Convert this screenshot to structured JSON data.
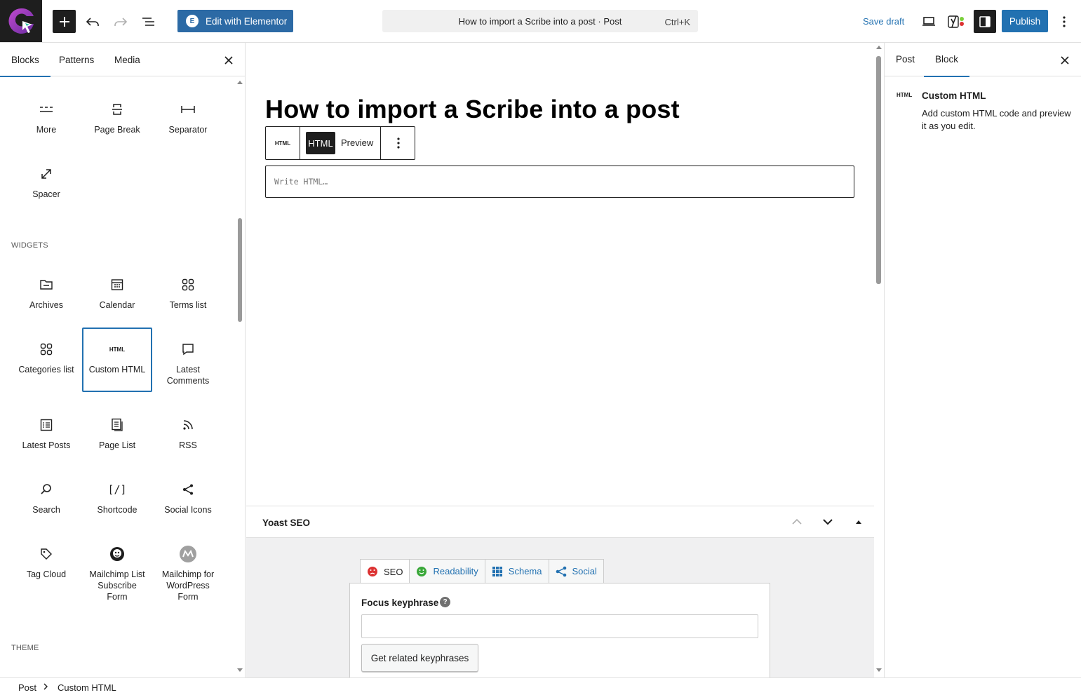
{
  "topbar": {
    "elementor_label": "Edit with Elementor",
    "document_title": "How to import a Scribe into a post · Post",
    "command_shortcut": "Ctrl+K",
    "save_draft": "Save draft",
    "publish": "Publish"
  },
  "inserter": {
    "tabs": [
      "Blocks",
      "Patterns",
      "Media"
    ],
    "active_tab": "Blocks",
    "design_blocks": [
      {
        "label": "More",
        "icon": "more-icon"
      },
      {
        "label": "Page Break",
        "icon": "page-break-icon"
      },
      {
        "label": "Separator",
        "icon": "separator-icon"
      },
      {
        "label": "Spacer",
        "icon": "spacer-icon"
      }
    ],
    "widgets_heading": "WIDGETS",
    "widget_blocks": [
      {
        "label": "Archives",
        "icon": "archives-icon"
      },
      {
        "label": "Calendar",
        "icon": "calendar-icon"
      },
      {
        "label": "Terms list",
        "icon": "terms-list-icon"
      },
      {
        "label": "Categories list",
        "icon": "categories-list-icon"
      },
      {
        "label": "Custom HTML",
        "icon": "custom-html-icon",
        "icon_text": "HTML"
      },
      {
        "label": "Latest Comments",
        "icon": "latest-comments-icon"
      },
      {
        "label": "Latest Posts",
        "icon": "latest-posts-icon"
      },
      {
        "label": "Page List",
        "icon": "page-list-icon"
      },
      {
        "label": "RSS",
        "icon": "rss-icon"
      },
      {
        "label": "Search",
        "icon": "search-icon"
      },
      {
        "label": "Shortcode",
        "icon": "shortcode-icon",
        "icon_text": "[/]"
      },
      {
        "label": "Social Icons",
        "icon": "share-icon"
      },
      {
        "label": "Tag Cloud",
        "icon": "tag-icon"
      },
      {
        "label": "Mailchimp List Subscribe Form",
        "icon": "mailchimp-icon"
      },
      {
        "label": "Mailchimp for WordPress Form",
        "icon": "mc4wp-icon"
      }
    ],
    "theme_heading": "THEME"
  },
  "editor": {
    "post_title": "How to import a Scribe into a post",
    "toolbar": {
      "block_icon_text": "HTML",
      "html_tab": "HTML",
      "preview_tab": "Preview"
    },
    "html_placeholder": "Write HTML…"
  },
  "yoast": {
    "title": "Yoast SEO",
    "tabs": [
      {
        "label": "SEO",
        "icon": "sad-face-icon",
        "color": "#dc3232"
      },
      {
        "label": "Readability",
        "icon": "smile-face-icon",
        "color": "#7ad03a"
      },
      {
        "label": "Schema",
        "icon": "grid-icon",
        "color": "#2271b1"
      },
      {
        "label": "Social",
        "icon": "share-icon",
        "color": "#2271b1"
      }
    ],
    "focus_keyphrase_label": "Focus keyphrase",
    "help_glyph": "?",
    "focus_keyphrase_value": "",
    "related_button": "Get related keyphrases"
  },
  "sidebar": {
    "tabs": [
      "Post",
      "Block"
    ],
    "active_tab": "Block",
    "block_icon_text": "HTML",
    "block_title": "Custom HTML",
    "block_description": "Add custom HTML code and preview it as you edit."
  },
  "breadcrumb": [
    "Post",
    "Custom HTML"
  ],
  "colors": {
    "accent": "#2271b1",
    "elementor": "#2c6aa5",
    "dark": "#1e1e1e"
  }
}
